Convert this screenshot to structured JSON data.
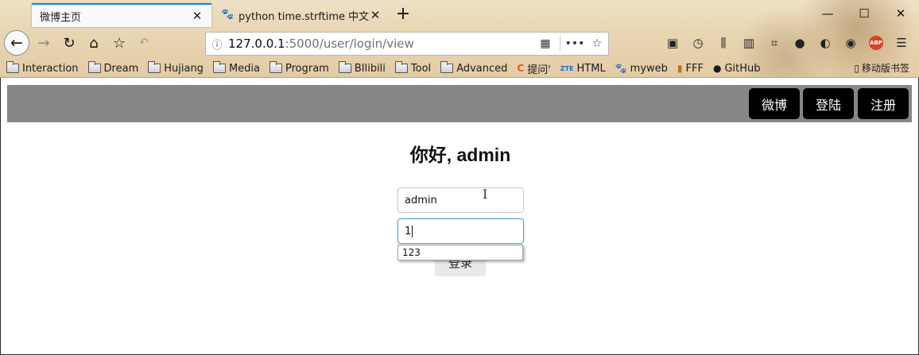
{
  "browser": {
    "tabs": [
      {
        "label": "微博主页",
        "active": true
      },
      {
        "label": "python time.strftime 中文_百",
        "active": false,
        "favicon": "baidu-paw-icon"
      }
    ],
    "url": {
      "host": "127.0.0.1",
      "rest": ":5000/user/login/view"
    },
    "bookmarks": [
      {
        "label": "Interaction",
        "icon": "folder-icon"
      },
      {
        "label": "Dream",
        "icon": "folder-icon"
      },
      {
        "label": "Hujiang",
        "icon": "folder-icon"
      },
      {
        "label": "Media",
        "icon": "folder-icon"
      },
      {
        "label": "Program",
        "icon": "folder-icon"
      },
      {
        "label": "BIlibili",
        "icon": "folder-icon"
      },
      {
        "label": "Tool",
        "icon": "folder-icon"
      },
      {
        "label": "Advanced",
        "icon": "folder-icon"
      },
      {
        "label": "提问'",
        "icon": "c-logo-icon"
      },
      {
        "label": "HTML",
        "icon": "zte-logo-icon",
        "icon_text": "ZTE"
      },
      {
        "label": "myweb",
        "icon": "paw-icon"
      },
      {
        "label": "FFF",
        "icon": "fff-icon"
      },
      {
        "label": "GitHub",
        "icon": "github-icon"
      }
    ],
    "mobile_bookmarks": "移动版书签",
    "accent": "#0a84ff"
  },
  "site": {
    "nav": [
      {
        "label": "微博"
      },
      {
        "label": "登陆"
      },
      {
        "label": "注册"
      }
    ],
    "greeting": "你好, admin",
    "username_value": "admin",
    "password_value": "1",
    "login_label": "登录",
    "autocomplete_option": "123",
    "nav_bg": "#878787"
  }
}
